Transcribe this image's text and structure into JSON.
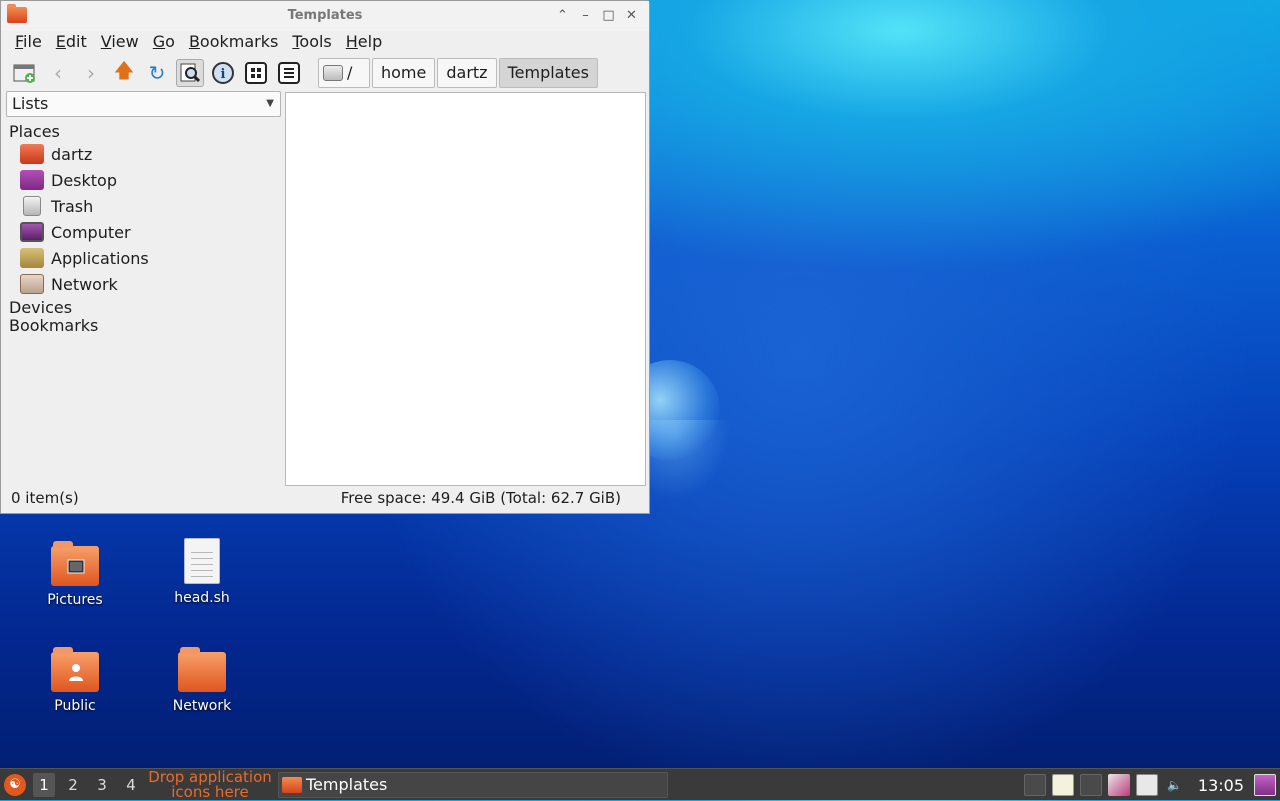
{
  "window": {
    "title": "Templates",
    "controls": {
      "minimize": "–",
      "maximize": "□",
      "shade": "⌃",
      "close": "✕"
    }
  },
  "menubar": [
    "File",
    "Edit",
    "View",
    "Go",
    "Bookmarks",
    "Tools",
    "Help"
  ],
  "toolbar": {
    "icons": [
      "new-tab-icon",
      "back-icon",
      "forward-icon",
      "up-icon",
      "reload-icon",
      "search-icon",
      "info-icon",
      "icon-view-icon",
      "list-view-icon"
    ]
  },
  "breadcrumb": [
    "/",
    "home",
    "dartz",
    "Templates"
  ],
  "sidepane": {
    "mode": "Lists",
    "sections": {
      "places": "Places",
      "devices": "Devices",
      "bookmarks": "Bookmarks"
    },
    "places": [
      {
        "label": "dartz",
        "color": "#d84b2a"
      },
      {
        "label": "Desktop",
        "color": "#8a2e8f"
      },
      {
        "label": "Trash",
        "color": "#cfcfcf"
      },
      {
        "label": "Computer",
        "color": "#7a3b86"
      },
      {
        "label": "Applications",
        "color": "#c2a14a"
      },
      {
        "label": "Network",
        "color": "#c35a26"
      }
    ]
  },
  "status": {
    "items": "0 item(s)",
    "free_space": "Free space: 49.4 GiB (Total: 62.7 GiB)"
  },
  "desktop_icons": [
    {
      "label": "Pictures",
      "type": "folder"
    },
    {
      "label": "head.sh",
      "type": "document"
    },
    {
      "label": "Public",
      "type": "folder"
    },
    {
      "label": "Network",
      "type": "folder"
    }
  ],
  "taskbar": {
    "workspaces": [
      "1",
      "2",
      "3",
      "4"
    ],
    "drop_hint": "Drop application icons here",
    "task_label": "Templates",
    "clock": "13:05"
  }
}
